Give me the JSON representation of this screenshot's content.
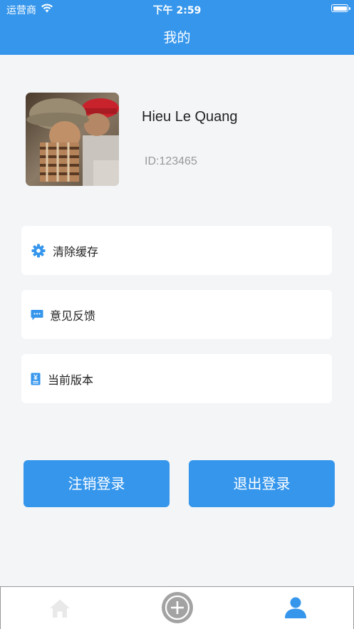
{
  "status_bar": {
    "carrier": "运营商",
    "time": "下午 2:59"
  },
  "nav": {
    "title": "我的"
  },
  "profile": {
    "name": "Hieu Le Quang",
    "id_text": "ID:123465"
  },
  "menu": {
    "items": [
      {
        "label": "清除缓存",
        "icon": "gear-icon"
      },
      {
        "label": "意见反馈",
        "icon": "chat-icon"
      },
      {
        "label": "当前版本",
        "icon": "document-icon"
      }
    ]
  },
  "actions": {
    "deregister_label": "注销登录",
    "logout_label": "退出登录"
  },
  "tabbar": {
    "tabs": [
      {
        "icon": "home-icon",
        "active": false
      },
      {
        "icon": "add-circle-icon",
        "active": false
      },
      {
        "icon": "user-icon",
        "active": true
      }
    ]
  },
  "colors": {
    "accent": "#3596ec",
    "background": "#f3f5f7",
    "text_secondary": "#999999"
  }
}
